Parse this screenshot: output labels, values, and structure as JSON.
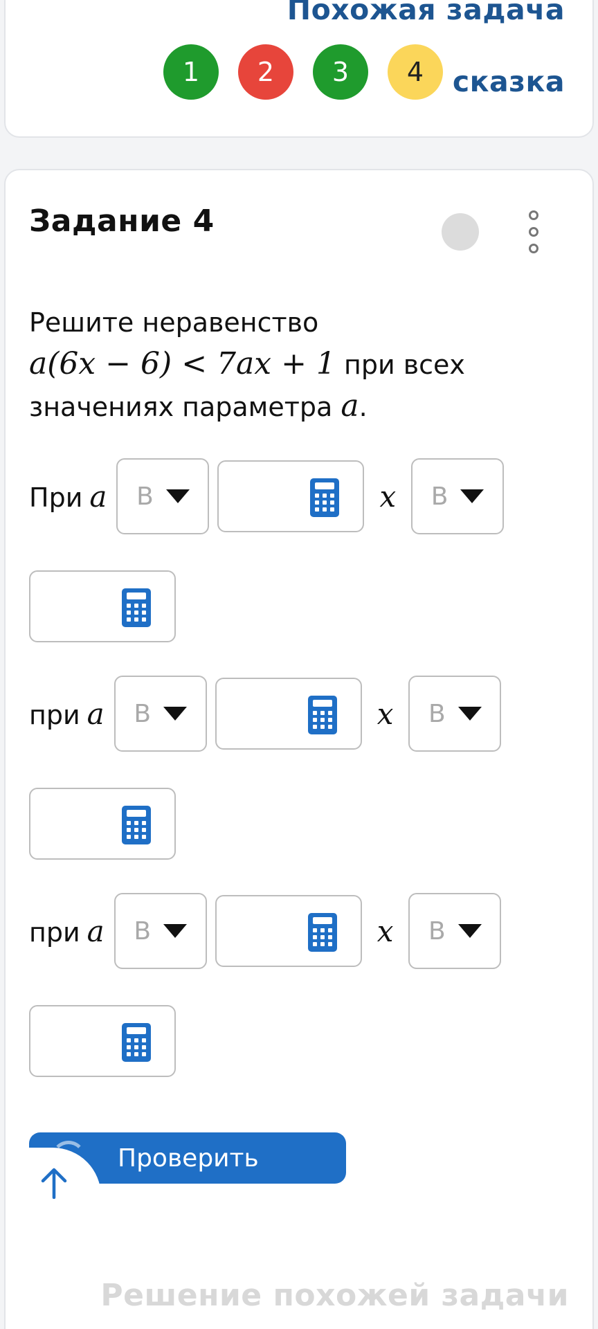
{
  "top_card": {
    "similar_task_link": "Похожая задача",
    "hint_link": "сказка",
    "task_numbers": [
      {
        "label": "1",
        "status": "green"
      },
      {
        "label": "2",
        "status": "red"
      },
      {
        "label": "3",
        "status": "green"
      },
      {
        "label": "4",
        "status": "yellow"
      }
    ]
  },
  "task": {
    "title": "Задание 4",
    "statement_start": "Решите неравенство",
    "inequality": "a(6x − 6) < 7ax + 1",
    "statement_mid": "при всех значениях параметра",
    "param": "a",
    "statement_end": "."
  },
  "rows": [
    {
      "label": "При",
      "var": "a",
      "select1": "B",
      "xvar": "x",
      "select2": "B"
    },
    {
      "label": "при",
      "var": "a",
      "select1": "B",
      "xvar": "x",
      "select2": "B"
    },
    {
      "label": "при",
      "var": "a",
      "select1": "B",
      "xvar": "x",
      "select2": "B"
    }
  ],
  "check_button": "Проверить",
  "solution_link": "Решение похожей задачи",
  "colors": {
    "accent": "#1f6fc6",
    "link": "#1d5591",
    "green": "#1f9b2d",
    "red": "#e7453b",
    "yellow": "#fbd65a"
  }
}
